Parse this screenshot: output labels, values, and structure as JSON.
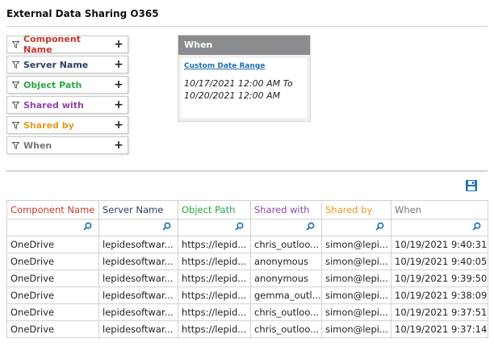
{
  "page": {
    "title": "External Data Sharing O365"
  },
  "colors": {
    "component": "#c0392b",
    "server": "#2c3e63",
    "object": "#27a844",
    "shared_with": "#8e44ad",
    "shared_by": "#e69a1d",
    "when": "#777777"
  },
  "filters": [
    {
      "label": "Component Name"
    },
    {
      "label": "Server Name"
    },
    {
      "label": "Object Path"
    },
    {
      "label": "Shared with"
    },
    {
      "label": "Shared by"
    },
    {
      "label": "When"
    }
  ],
  "filter_add_label": "+",
  "when_panel": {
    "title": "When",
    "link": "Custom Date Range",
    "range_line1": "10/17/2021 12:00 AM To",
    "range_line2": "10/20/2021 12:00 AM"
  },
  "table": {
    "columns": [
      "Component Name",
      "Server Name",
      "Object Path",
      "Shared with",
      "Shared by",
      "When"
    ],
    "rows": [
      [
        "OneDrive",
        "lepidesoftwar...",
        "https://lepid...",
        "chris_outloo...",
        "simon@lepi...",
        "10/19/2021 9:40:31"
      ],
      [
        "OneDrive",
        "lepidesoftwar...",
        "https://lepid...",
        "anonymous",
        "simon@lepi...",
        "10/19/2021 9:40:05"
      ],
      [
        "OneDrive",
        "lepidesoftwar...",
        "https://lepid...",
        "anonymous",
        "simon@lepi...",
        "10/19/2021 9:39:50"
      ],
      [
        "OneDrive",
        "lepidesoftwar...",
        "https://lepid...",
        "gemma_outl...",
        "simon@lepi...",
        "10/19/2021 9:38:09"
      ],
      [
        "OneDrive",
        "lepidesoftwar...",
        "https://lepid...",
        "chris_outloo...",
        "simon@lepi...",
        "10/19/2021 9:37:51"
      ],
      [
        "OneDrive",
        "lepidesoftwar...",
        "https://lepid...",
        "chris_outloo...",
        "simon@lepi...",
        "10/19/2021 9:37:14"
      ]
    ]
  }
}
